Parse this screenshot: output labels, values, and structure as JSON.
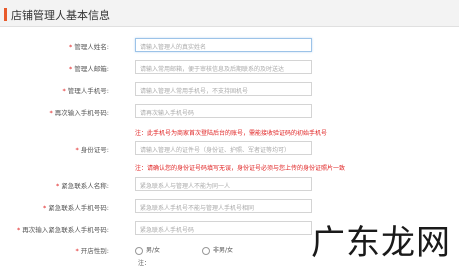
{
  "header": {
    "title": "店铺管理人基本信息"
  },
  "fields": [
    {
      "label": "管理人姓名:",
      "required": true,
      "placeholder": "请输入管理人的真实姓名"
    },
    {
      "label": "管理人邮箱:",
      "required": true,
      "placeholder": "请输入常用邮箱，便于审核信息及后期联系的及时送达"
    },
    {
      "label": "管理人手机号:",
      "required": true,
      "placeholder": "请输入管理人常用手机号，不支持固机号"
    },
    {
      "label": "再次输入手机号码:",
      "required": true,
      "placeholder": "请再次输入手机号码"
    },
    {
      "label": "身份证号:",
      "required": true,
      "placeholder": "请输入管理人的证件号（身份证、护照、军者证等均可）"
    },
    {
      "label": "紧急联系人名称:",
      "required": true,
      "placeholder": "紧急联系人与管理人不能为同一人"
    },
    {
      "label": "紧急联系人手机号码:",
      "required": true,
      "placeholder": "紧急联系人手机号不能与管理人手机号相同"
    },
    {
      "label": "再次输入紧急联系人手机号码:",
      "required": true,
      "placeholder": "紧急联系人手机号码"
    }
  ],
  "notes": {
    "phone": "注：此手机号为商家首次登陆后台的账号，需能接收验证码的初始手机号",
    "id": "注：请确认您的身份证号码填写无误，身份证号必须与您上传的身份证照片一致"
  },
  "gender": {
    "label": "开店性别:",
    "options": [
      "男/女",
      "非男/女"
    ]
  },
  "footer_note": "注：",
  "watermark": "广东龙网"
}
